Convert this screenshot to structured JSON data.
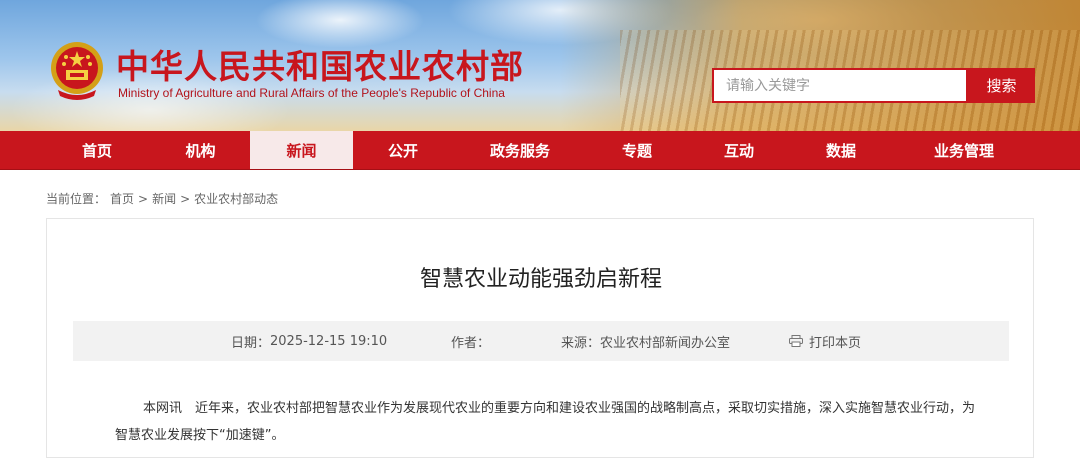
{
  "header": {
    "title_cn": "中华人民共和国农业农村部",
    "title_en": "Ministry of Agriculture and Rural Affairs of the People's Republic of China",
    "brand_color": "#c8161d"
  },
  "search": {
    "placeholder": "请输入关键字",
    "button_label": "搜索"
  },
  "nav": {
    "items": [
      {
        "label": "首页"
      },
      {
        "label": "机构"
      },
      {
        "label": "新闻",
        "active": true
      },
      {
        "label": "公开"
      },
      {
        "label": "政务服务"
      },
      {
        "label": "专题"
      },
      {
        "label": "互动"
      },
      {
        "label": "数据"
      },
      {
        "label": "业务管理"
      }
    ]
  },
  "breadcrumb": {
    "prefix": "当前位置：",
    "items": [
      "首页",
      "新闻",
      "农业农村部动态"
    ],
    "separator": ">"
  },
  "article": {
    "title": "智慧农业动能强劲启新程",
    "date_label": "日期：",
    "date_value": "2025-12-15 19:10",
    "author_label": "作者：",
    "author_value": "",
    "source_label": "来源：",
    "source_value": "农业农村部新闻办公室",
    "print_label": "打印本页",
    "print_icon": "printer-icon",
    "body": "本网讯　近年来，农业农村部把智慧农业作为发展现代农业的重要方向和建设农业强国的战略制高点，采取切实措施，深入实施智慧农业行动，为智慧农业发展按下“加速键”。"
  }
}
